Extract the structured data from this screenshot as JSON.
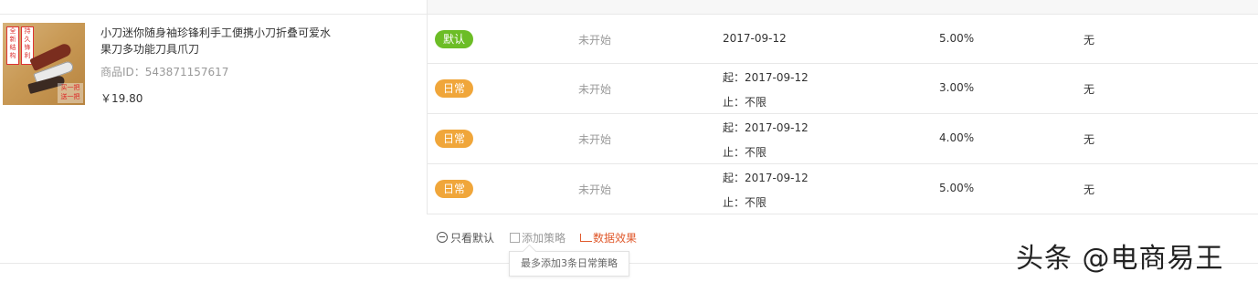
{
  "product": {
    "title": "小刀迷你随身袖珍锋利手工便携小刀折叠可爱水果刀多功能刀具爪刀",
    "id_text": "商品ID：543871157617",
    "price": "￥19.80",
    "image_alt": "knife-product-image"
  },
  "rows": [
    {
      "type_label": "默认",
      "type_color": "#6cbd26",
      "status": "未开始",
      "date_start": "2017-09-12",
      "date_end": "",
      "rate": "5.00%",
      "extra": "无"
    },
    {
      "type_label": "日常",
      "type_color": "#f0a63a",
      "status": "未开始",
      "date_start": "起：2017-09-12",
      "date_end": "止：不限",
      "rate": "3.00%",
      "extra": "无"
    },
    {
      "type_label": "日常",
      "type_color": "#f0a63a",
      "status": "未开始",
      "date_start": "起：2017-09-12",
      "date_end": "止：不限",
      "rate": "4.00%",
      "extra": "无"
    },
    {
      "type_label": "日常",
      "type_color": "#f0a63a",
      "status": "未开始",
      "date_start": "起：2017-09-12",
      "date_end": "止：不限",
      "rate": "5.00%",
      "extra": "无"
    }
  ],
  "actions": {
    "only_default": "只看默认",
    "add_strategy": "添加策略",
    "data_effect": "数据效果"
  },
  "tooltip": "最多添加3条日常策略",
  "watermark": "头条 @电商易王"
}
